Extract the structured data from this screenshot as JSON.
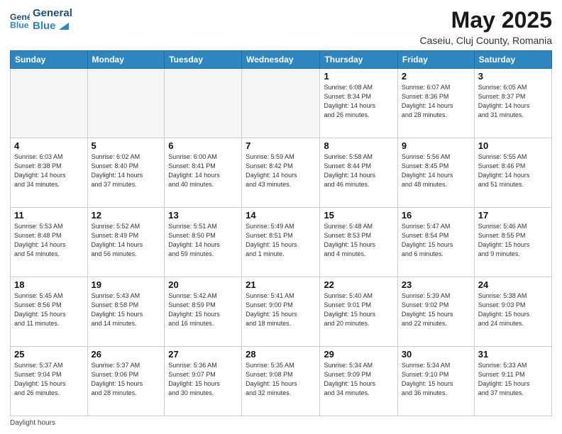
{
  "header": {
    "logo_line1": "General",
    "logo_line2": "Blue",
    "month_title": "May 2025",
    "location": "Caseiu, Cluj County, Romania"
  },
  "weekdays": [
    "Sunday",
    "Monday",
    "Tuesday",
    "Wednesday",
    "Thursday",
    "Friday",
    "Saturday"
  ],
  "weeks": [
    [
      {
        "day": "",
        "info": ""
      },
      {
        "day": "",
        "info": ""
      },
      {
        "day": "",
        "info": ""
      },
      {
        "day": "",
        "info": ""
      },
      {
        "day": "1",
        "info": "Sunrise: 6:08 AM\nSunset: 8:34 PM\nDaylight: 14 hours\nand 26 minutes."
      },
      {
        "day": "2",
        "info": "Sunrise: 6:07 AM\nSunset: 8:36 PM\nDaylight: 14 hours\nand 28 minutes."
      },
      {
        "day": "3",
        "info": "Sunrise: 6:05 AM\nSunset: 8:37 PM\nDaylight: 14 hours\nand 31 minutes."
      }
    ],
    [
      {
        "day": "4",
        "info": "Sunrise: 6:03 AM\nSunset: 8:38 PM\nDaylight: 14 hours\nand 34 minutes."
      },
      {
        "day": "5",
        "info": "Sunrise: 6:02 AM\nSunset: 8:40 PM\nDaylight: 14 hours\nand 37 minutes."
      },
      {
        "day": "6",
        "info": "Sunrise: 6:00 AM\nSunset: 8:41 PM\nDaylight: 14 hours\nand 40 minutes."
      },
      {
        "day": "7",
        "info": "Sunrise: 5:59 AM\nSunset: 8:42 PM\nDaylight: 14 hours\nand 43 minutes."
      },
      {
        "day": "8",
        "info": "Sunrise: 5:58 AM\nSunset: 8:44 PM\nDaylight: 14 hours\nand 46 minutes."
      },
      {
        "day": "9",
        "info": "Sunrise: 5:56 AM\nSunset: 8:45 PM\nDaylight: 14 hours\nand 48 minutes."
      },
      {
        "day": "10",
        "info": "Sunrise: 5:55 AM\nSunset: 8:46 PM\nDaylight: 14 hours\nand 51 minutes."
      }
    ],
    [
      {
        "day": "11",
        "info": "Sunrise: 5:53 AM\nSunset: 8:48 PM\nDaylight: 14 hours\nand 54 minutes."
      },
      {
        "day": "12",
        "info": "Sunrise: 5:52 AM\nSunset: 8:49 PM\nDaylight: 14 hours\nand 56 minutes."
      },
      {
        "day": "13",
        "info": "Sunrise: 5:51 AM\nSunset: 8:50 PM\nDaylight: 14 hours\nand 59 minutes."
      },
      {
        "day": "14",
        "info": "Sunrise: 5:49 AM\nSunset: 8:51 PM\nDaylight: 15 hours\nand 1 minute."
      },
      {
        "day": "15",
        "info": "Sunrise: 5:48 AM\nSunset: 8:53 PM\nDaylight: 15 hours\nand 4 minutes."
      },
      {
        "day": "16",
        "info": "Sunrise: 5:47 AM\nSunset: 8:54 PM\nDaylight: 15 hours\nand 6 minutes."
      },
      {
        "day": "17",
        "info": "Sunrise: 5:46 AM\nSunset: 8:55 PM\nDaylight: 15 hours\nand 9 minutes."
      }
    ],
    [
      {
        "day": "18",
        "info": "Sunrise: 5:45 AM\nSunset: 8:56 PM\nDaylight: 15 hours\nand 11 minutes."
      },
      {
        "day": "19",
        "info": "Sunrise: 5:43 AM\nSunset: 8:58 PM\nDaylight: 15 hours\nand 14 minutes."
      },
      {
        "day": "20",
        "info": "Sunrise: 5:42 AM\nSunset: 8:59 PM\nDaylight: 15 hours\nand 16 minutes."
      },
      {
        "day": "21",
        "info": "Sunrise: 5:41 AM\nSunset: 9:00 PM\nDaylight: 15 hours\nand 18 minutes."
      },
      {
        "day": "22",
        "info": "Sunrise: 5:40 AM\nSunset: 9:01 PM\nDaylight: 15 hours\nand 20 minutes."
      },
      {
        "day": "23",
        "info": "Sunrise: 5:39 AM\nSunset: 9:02 PM\nDaylight: 15 hours\nand 22 minutes."
      },
      {
        "day": "24",
        "info": "Sunrise: 5:38 AM\nSunset: 9:03 PM\nDaylight: 15 hours\nand 24 minutes."
      }
    ],
    [
      {
        "day": "25",
        "info": "Sunrise: 5:37 AM\nSunset: 9:04 PM\nDaylight: 15 hours\nand 26 minutes."
      },
      {
        "day": "26",
        "info": "Sunrise: 5:37 AM\nSunset: 9:06 PM\nDaylight: 15 hours\nand 28 minutes."
      },
      {
        "day": "27",
        "info": "Sunrise: 5:36 AM\nSunset: 9:07 PM\nDaylight: 15 hours\nand 30 minutes."
      },
      {
        "day": "28",
        "info": "Sunrise: 5:35 AM\nSunset: 9:08 PM\nDaylight: 15 hours\nand 32 minutes."
      },
      {
        "day": "29",
        "info": "Sunrise: 5:34 AM\nSunset: 9:09 PM\nDaylight: 15 hours\nand 34 minutes."
      },
      {
        "day": "30",
        "info": "Sunrise: 5:34 AM\nSunset: 9:10 PM\nDaylight: 15 hours\nand 36 minutes."
      },
      {
        "day": "31",
        "info": "Sunrise: 5:33 AM\nSunset: 9:11 PM\nDaylight: 15 hours\nand 37 minutes."
      }
    ]
  ],
  "footer": {
    "note": "Daylight hours"
  }
}
